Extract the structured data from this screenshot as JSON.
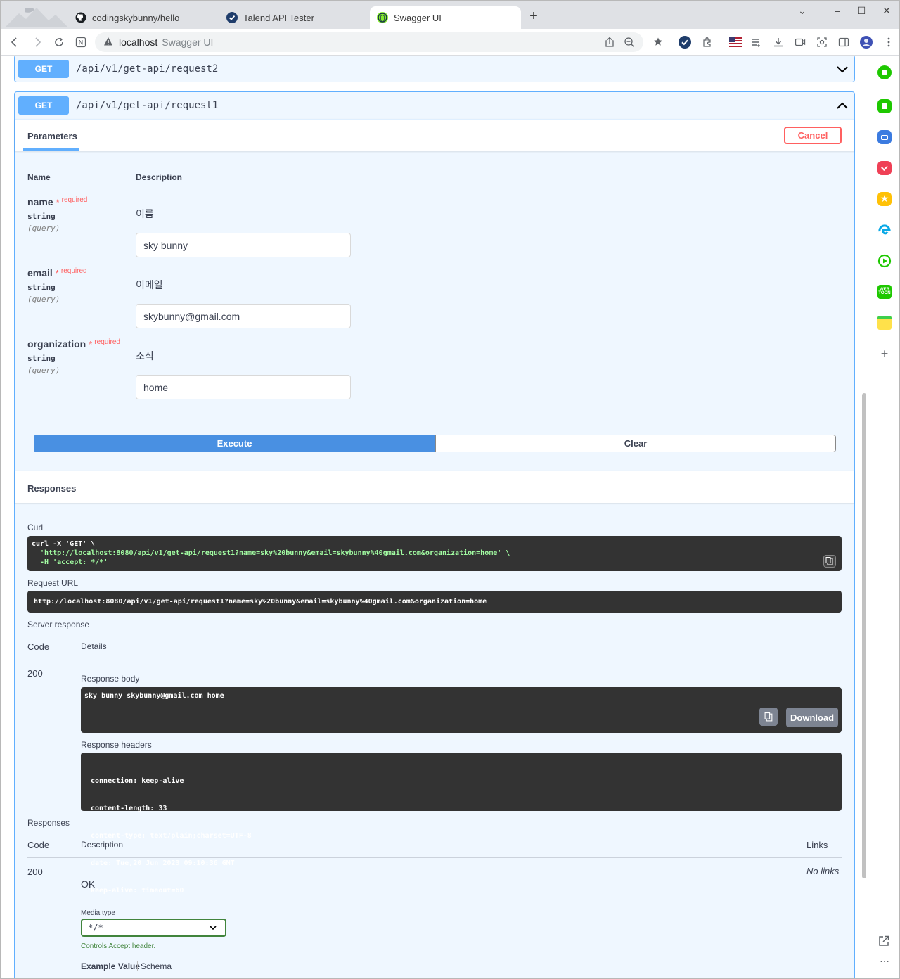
{
  "browser": {
    "tabs": [
      {
        "title": "codingskybunny/hello",
        "icon": "github-icon"
      },
      {
        "title": "Talend API Tester",
        "icon": "check-circle-icon"
      },
      {
        "title": "Swagger UI",
        "icon": "swagger-icon"
      }
    ],
    "new_tab": "+",
    "address": {
      "host": "localhost",
      "title": "Swagger UI"
    }
  },
  "colors": {
    "get": "#61affe",
    "execute": "#4990e2",
    "cancel": "#ff6060",
    "dark": "#333333"
  },
  "ops": [
    {
      "method": "GET",
      "path": "/api/v1/get-api/request2",
      "expanded": false
    },
    {
      "method": "GET",
      "path": "/api/v1/get-api/request1",
      "expanded": true
    }
  ],
  "params_section": {
    "tab": "Parameters",
    "cancel": "Cancel",
    "col_name": "Name",
    "col_description": "Description",
    "required_label": "required",
    "params": [
      {
        "name": "name",
        "type": "string",
        "in": "(query)",
        "description": "이름",
        "value": "sky bunny"
      },
      {
        "name": "email",
        "type": "string",
        "in": "(query)",
        "description": "이메일",
        "value": "skybunny@gmail.com"
      },
      {
        "name": "organization",
        "type": "string",
        "in": "(query)",
        "description": "조직",
        "value": "home"
      }
    ],
    "execute": "Execute",
    "clear": "Clear"
  },
  "responses": {
    "title": "Responses",
    "curl_label": "Curl",
    "curl_line1": "curl -X 'GET' \\",
    "curl_line2": "  'http://localhost:8080/api/v1/get-api/request1?name=sky%20bunny&email=skybunny%40gmail.com&organization=home' \\",
    "curl_line3": "  -H 'accept: */*'",
    "request_url_label": "Request URL",
    "request_url": "http://localhost:8080/api/v1/get-api/request1?name=sky%20bunny&email=skybunny%40gmail.com&organization=home",
    "server_response_label": "Server response",
    "col_code": "Code",
    "col_details": "Details",
    "code": "200",
    "response_body_label": "Response body",
    "response_body": "sky bunny skybunny@gmail.com home",
    "download": "Download",
    "response_headers_label": "Response headers",
    "headers": [
      "connection: keep-alive",
      "content-length: 33",
      "content-type: text/plain;charset=UTF-8",
      "date: Tue,20 Jun 2023 09:10:36 GMT",
      "keep-alive: timeout=60"
    ]
  },
  "spec_responses": {
    "title": "Responses",
    "col_code": "Code",
    "col_description": "Description",
    "col_links": "Links",
    "code": "200",
    "description": "OK",
    "links": "No links",
    "media_type_label": "Media type",
    "media_type": "*/*",
    "controls": "Controls Accept header.",
    "example_value": "Example Value",
    "schema": "Schema"
  }
}
